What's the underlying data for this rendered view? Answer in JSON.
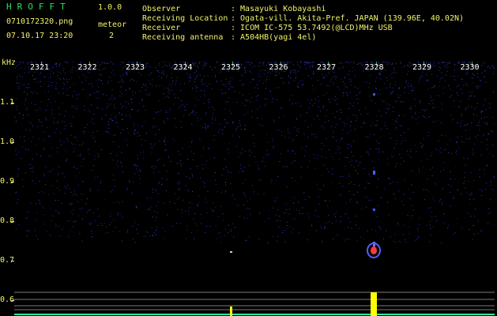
{
  "app": {
    "title": "HROFFT",
    "version": "1.0.0"
  },
  "file": {
    "name": "0710172320.png",
    "datetime": "07.10.17 23:20"
  },
  "meteor": {
    "label": "meteor",
    "count": "2"
  },
  "info": [
    {
      "key": "Observer",
      "value": ": Masayuki Kobayashi"
    },
    {
      "key": "Receiving Location",
      "value": ": Ogata-vill. Akita-Pref. JAPAN (139.96E, 40.02N)"
    },
    {
      "key": "Receiver",
      "value": ": ICOM IC-575 53.7492(@LCD)MHz USB"
    },
    {
      "key": "Receiving antenna",
      "value": ": A504HB(yagi 4el)"
    }
  ],
  "axis": {
    "y_unit": "kHz",
    "y_ticks": [
      "1.1",
      "1.0",
      "0.9",
      "0.8",
      "0.7",
      "0.6"
    ],
    "x_ticks": [
      "2321",
      "2322",
      "2323",
      "2324",
      "2325",
      "2326",
      "2327",
      "2328",
      "2329",
      "2330"
    ]
  },
  "colors": {
    "noise": "#2a35c8",
    "signal": "#ffff00",
    "hot": "#ff3a3a",
    "grid": "#7a7a7a"
  }
}
